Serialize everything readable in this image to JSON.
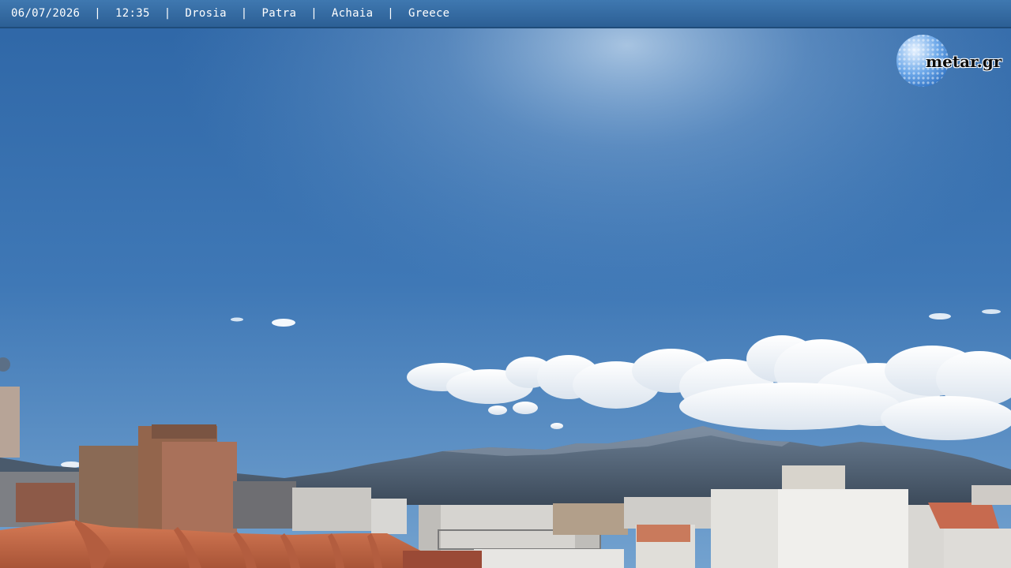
{
  "overlay": {
    "date": "06/07/2026",
    "time": "12:35",
    "location": "Drosia",
    "city": "Patra",
    "region": "Achaia",
    "country": "Greece",
    "separator": "|"
  },
  "logo": {
    "text": "metar.gr"
  },
  "colors": {
    "bar": "#34689f",
    "sky_top": "#2f6aaa",
    "sky_horizon": "#6f9fcf",
    "mountain": "#4d5f73",
    "roof": "#c46a49"
  }
}
